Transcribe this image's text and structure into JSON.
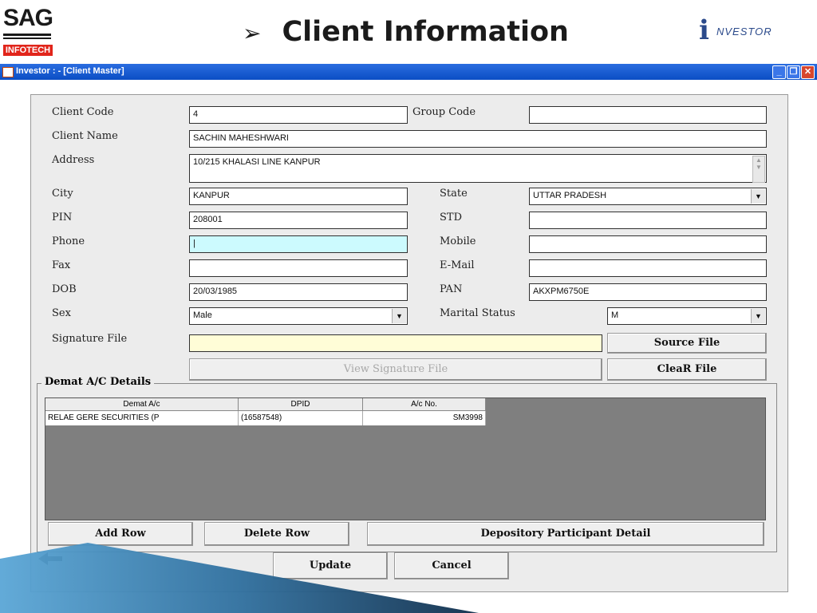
{
  "slide": {
    "logo_left_top": "SAG",
    "logo_left_bottom": "INFOTECH",
    "title": "Client Information",
    "logo_right_initial": "i",
    "logo_right_word": "NVESTOR"
  },
  "window": {
    "title": "Investor : - [Client Master]"
  },
  "form": {
    "client_code_label": "Client Code",
    "client_code": "4",
    "group_code_label": "Group Code",
    "group_code": "",
    "client_name_label": "Client Name",
    "client_name": "SACHIN MAHESHWARI",
    "address_label": "Address",
    "address": "10/215 KHALASI LINE KANPUR",
    "city_label": "City",
    "city": "KANPUR",
    "state_label": "State",
    "state": "UTTAR PRADESH",
    "pin_label": "PIN",
    "pin": "208001",
    "std_label": "STD",
    "std": "",
    "phone_label": "Phone",
    "phone": "|",
    "mobile_label": "Mobile",
    "mobile": "",
    "fax_label": "Fax",
    "fax": "",
    "email_label": "E-Mail",
    "email": "",
    "dob_label": "DOB",
    "dob": "20/03/1985",
    "pan_label": "PAN",
    "pan": "AKXPM6750E",
    "sex_label": "Sex",
    "sex": "Male",
    "marital_label": "Marital Status",
    "marital": "M",
    "signature_label": "Signature File",
    "signature": ""
  },
  "buttons": {
    "source_file": "Source File",
    "view_signature": "View Signature File",
    "clear_file": "CleaR File",
    "add_row": "Add Row",
    "delete_row": "Delete Row",
    "dp_detail": "Depository Participant Detail",
    "update": "Update",
    "cancel": "Cancel"
  },
  "demat": {
    "group_label": "Demat A/C Details",
    "columns": [
      "Demat A/c",
      "DPID",
      "A/c No."
    ],
    "rows": [
      [
        "RELAE GERE SECURITIES (P",
        "(16587548)",
        "SM3998"
      ]
    ]
  }
}
